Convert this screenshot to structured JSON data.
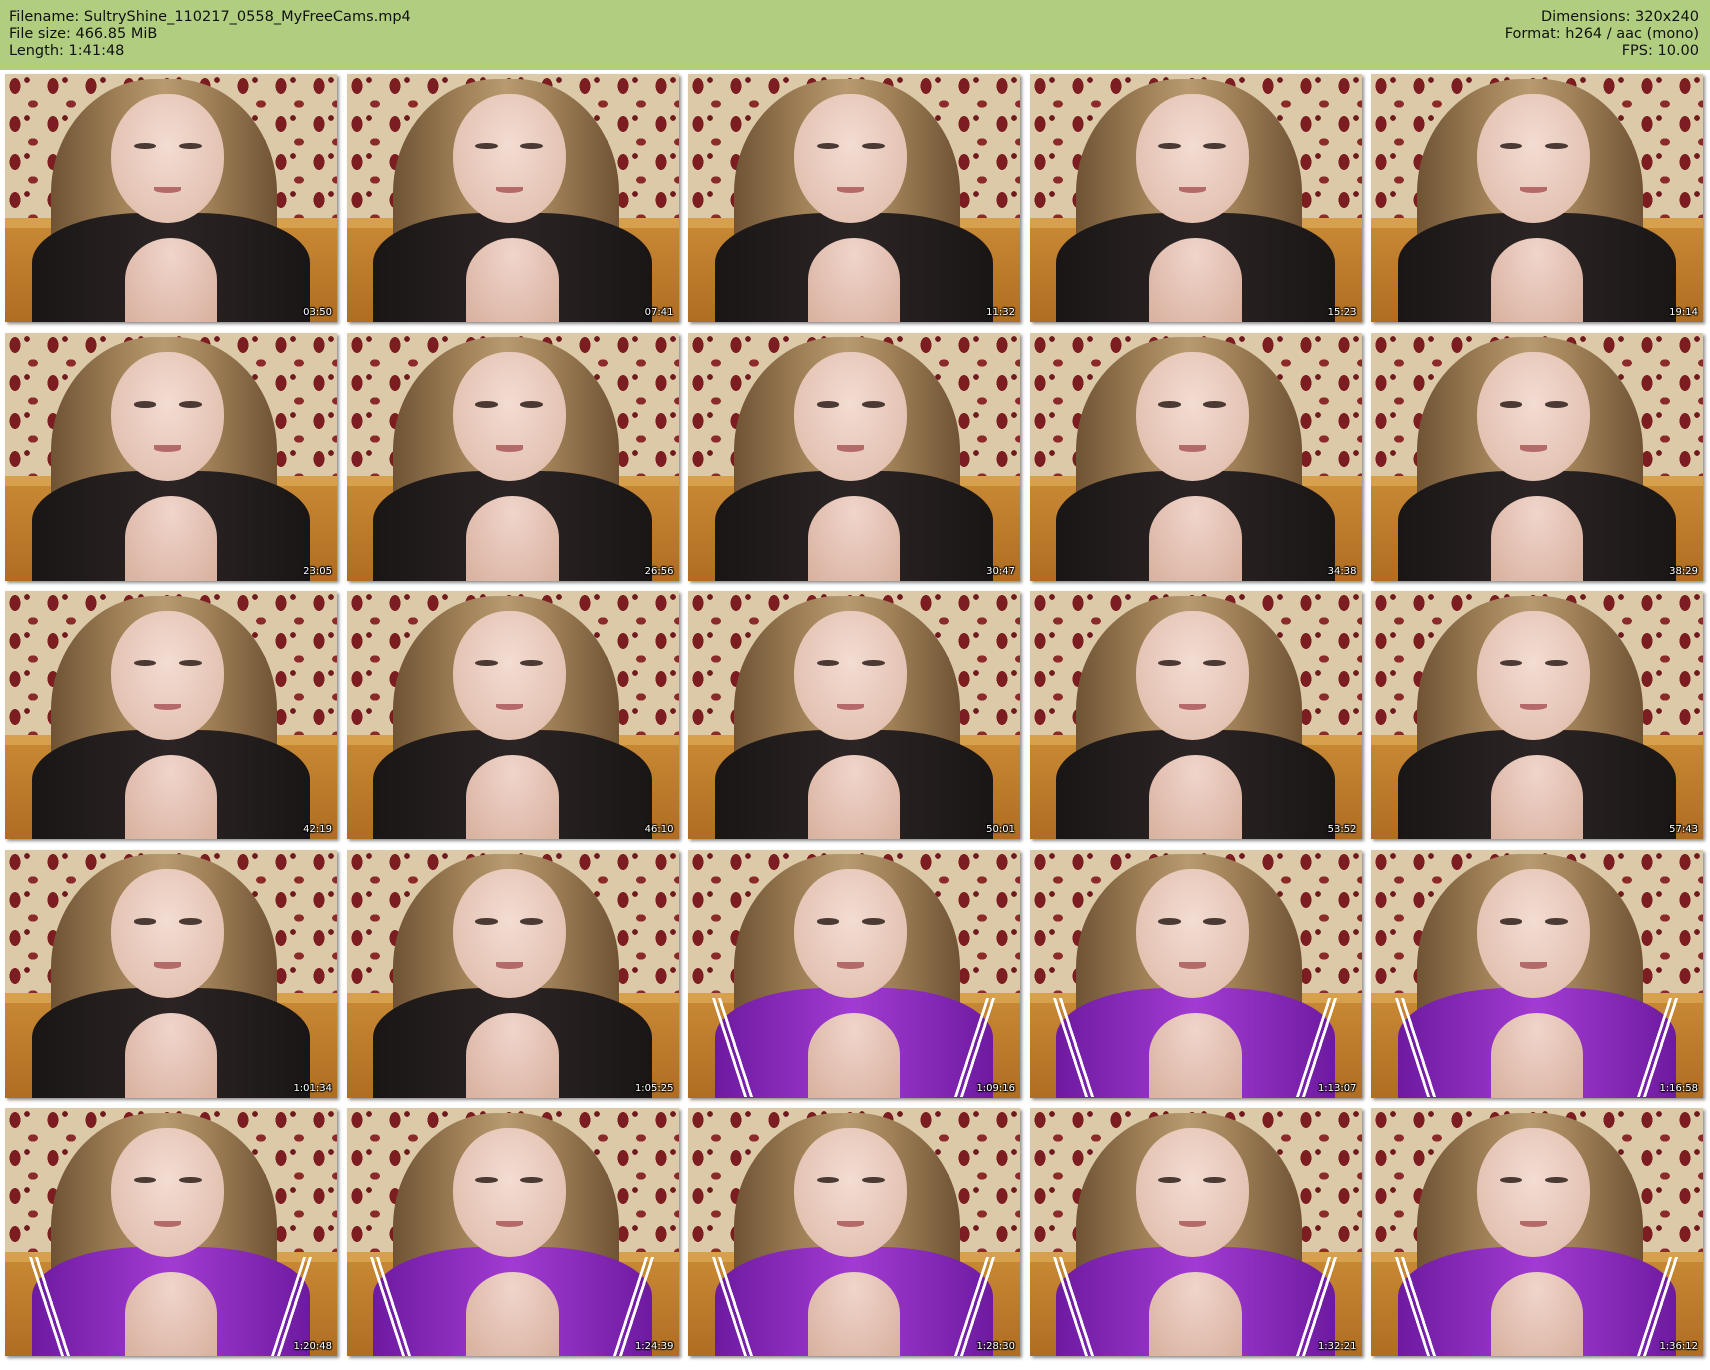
{
  "header": {
    "filename": "Filename: SultryShine_110217_0558_MyFreeCams.mp4",
    "filesize": "File size: 466.85 MiB",
    "length": "Length: 1:41:48",
    "dimensions": "Dimensions: 320x240",
    "format": "Format: h264 / aac (mono)",
    "fps": "FPS: 10.00"
  },
  "colors": {
    "header_bg": "#b1cd80",
    "top_black": "#1a1616",
    "top_purple": "#a23bd2"
  },
  "thumbnails": [
    {
      "time": "03:50",
      "top": "black"
    },
    {
      "time": "07:41",
      "top": "black"
    },
    {
      "time": "11:32",
      "top": "black"
    },
    {
      "time": "15:23",
      "top": "black"
    },
    {
      "time": "19:14",
      "top": "black"
    },
    {
      "time": "23:05",
      "top": "black"
    },
    {
      "time": "26:56",
      "top": "black"
    },
    {
      "time": "30:47",
      "top": "black"
    },
    {
      "time": "34:38",
      "top": "black"
    },
    {
      "time": "38:29",
      "top": "black"
    },
    {
      "time": "42:19",
      "top": "black"
    },
    {
      "time": "46:10",
      "top": "black"
    },
    {
      "time": "50:01",
      "top": "black"
    },
    {
      "time": "53:52",
      "top": "black"
    },
    {
      "time": "57:43",
      "top": "black"
    },
    {
      "time": "1:01:34",
      "top": "black"
    },
    {
      "time": "1:05:25",
      "top": "black"
    },
    {
      "time": "1:09:16",
      "top": "purple"
    },
    {
      "time": "1:13:07",
      "top": "purple"
    },
    {
      "time": "1:16:58",
      "top": "purple"
    },
    {
      "time": "1:20:48",
      "top": "purple"
    },
    {
      "time": "1:24:39",
      "top": "purple"
    },
    {
      "time": "1:28:30",
      "top": "purple"
    },
    {
      "time": "1:32:21",
      "top": "purple"
    },
    {
      "time": "1:36:12",
      "top": "purple"
    }
  ]
}
